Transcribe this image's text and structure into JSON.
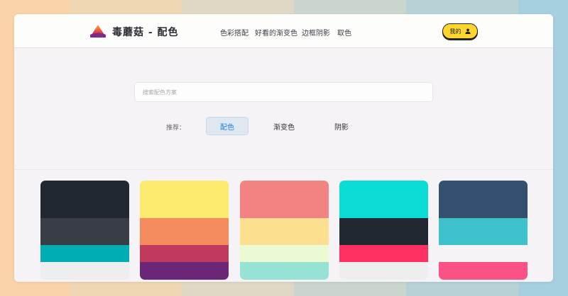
{
  "header": {
    "brand": "毒蘑菇 - 配色",
    "nav": [
      "色彩搭配",
      "好看的渐变色",
      "边框阴影",
      "取色"
    ],
    "user_button": "我的",
    "logo_colors": [
      "#f4b233",
      "#e8473d",
      "#7f2a8a"
    ]
  },
  "search": {
    "placeholder": "搜索配色方案",
    "value": ""
  },
  "recommend": {
    "label": "推荐：",
    "tabs": [
      "配色",
      "渐变色",
      "阴影"
    ],
    "active": "配色"
  },
  "colors": {
    "accent": "#1e7fe0",
    "button": "#fcd52f"
  },
  "palettes": [
    {
      "swatches": [
        {
          "color": "#222831",
          "share": 0.375
        },
        {
          "color": "#393e46",
          "share": 0.271
        },
        {
          "color": "#00adb5",
          "share": 0.171
        },
        {
          "color": "#eeeeee",
          "share": 0.183
        }
      ]
    },
    {
      "swatches": [
        {
          "color": "#fcea6e",
          "share": 0.375
        },
        {
          "color": "#f38b5d",
          "share": 0.271
        },
        {
          "color": "#c03a5c",
          "share": 0.171
        },
        {
          "color": "#6b2677",
          "share": 0.183
        }
      ]
    },
    {
      "swatches": [
        {
          "color": "#f38282",
          "share": 0.375
        },
        {
          "color": "#fce08f",
          "share": 0.271
        },
        {
          "color": "#ecfad3",
          "share": 0.171
        },
        {
          "color": "#96e2d4",
          "share": 0.183
        }
      ]
    },
    {
      "swatches": [
        {
          "color": "#0adcd6",
          "share": 0.375
        },
        {
          "color": "#222831",
          "share": 0.271
        },
        {
          "color": "#ff2e63",
          "share": 0.171
        },
        {
          "color": "#eeeeee",
          "share": 0.183
        }
      ]
    },
    {
      "swatches": [
        {
          "color": "#354f6f",
          "share": 0.375
        },
        {
          "color": "#3fc1cc",
          "share": 0.271
        },
        {
          "color": "#f5f3f6",
          "share": 0.171
        },
        {
          "color": "#fc5185",
          "share": 0.183
        }
      ]
    }
  ]
}
